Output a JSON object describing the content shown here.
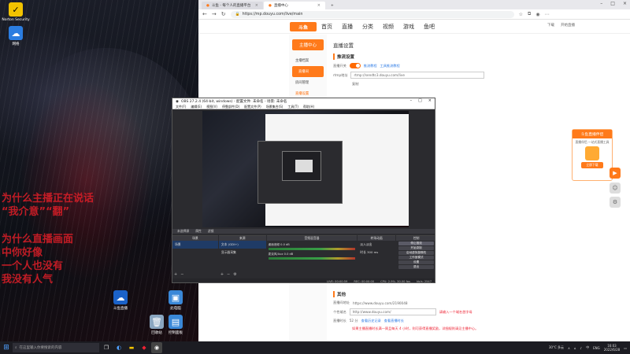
{
  "desktop": {
    "icons": [
      {
        "label": "Norton Security",
        "glyph": "✓",
        "color": "#f2c300"
      },
      {
        "label": "网络",
        "glyph": "☁",
        "color": "#2b7de0"
      },
      {
        "label": "斗鱼直播",
        "glyph": "☁",
        "color": "#1b62c8"
      },
      {
        "label": "此电脑",
        "glyph": "▣",
        "color": "#3a88d8"
      },
      {
        "label": "回收站",
        "glyph": "🗑",
        "color": "#8aa6c0"
      },
      {
        "label": "控制面板",
        "glyph": "▤",
        "color": "#3a88d8"
      }
    ],
    "red_text": [
      "为什么主播正在说话",
      "“我介意”“翻”",
      "为什么直播画面",
      "中你好像",
      "一个人也没有",
      "我没有人气"
    ]
  },
  "browser": {
    "tabs": [
      {
        "label": "斗鱼 - 每个人的直播平台"
      },
      {
        "label": "直播中心"
      }
    ],
    "nav_back": "←",
    "nav_forward": "→",
    "nav_reload": "↻",
    "url": "https://mp.douyu.com/live/main",
    "site": {
      "logo": "斗鱼",
      "nav": [
        "首页",
        "直播",
        "分类",
        "视频",
        "游戏",
        "鱼吧"
      ],
      "header_right": [
        "下载",
        "开始直播"
      ],
      "sidebar_title": "主播中心",
      "sidebar_items": [
        "主播档案",
        "直播间",
        "房间管理",
        "直播设置"
      ],
      "page_title": "直播设置",
      "section_title": "推流设置",
      "rows": [
        {
          "label": "直播开关",
          "value": "",
          "links": [
            "推流教程",
            "工具推流教程"
          ]
        },
        {
          "label": "rtmp地址",
          "value": "rtmp://sendtc3.douyu.com/live"
        },
        {
          "label": "",
          "value": "复制"
        }
      ],
      "sec2_title": "其他",
      "sec2_rows": [
        {
          "label": "直播间地址",
          "value": "https://www.douyu.com/2190048"
        },
        {
          "label": "个性域名",
          "value": "http://www.douyu.com/",
          "note": "请输入一个域名首字母"
        },
        {
          "label": "直播时长",
          "value": "52 分",
          "links": [
            "查看历史记录",
            "查看直播时长"
          ]
        }
      ],
      "footer_note": "如果主播直播时长满一周且每天 4 小时，则可获得直播奖励，详细规则请见主播中心。",
      "promo": {
        "title": "斗鱼直播伴侣",
        "subtitle": "直播伴侣 一站式直播工具",
        "button": "立即下载"
      }
    }
  },
  "obs": {
    "title": "OBS 27.2.4 (64-bit, windows) - 配置文件: 未命名 - 场景: 未命名",
    "menu": [
      "文件(F)",
      "编辑(E)",
      "视图(V)",
      "停靠部件(D)",
      "配置文件(P)",
      "场景集合(S)",
      "工具(T)",
      "帮助(H)"
    ],
    "status_line": [
      "未选择源",
      "属性",
      "滤镜"
    ],
    "docks": {
      "scenes": {
        "title": "场景",
        "items": [
          "场景"
        ]
      },
      "sources": {
        "title": "来源",
        "items": [
          "文本 (GDI+)",
          "显示器采集"
        ]
      },
      "mixer": {
        "title": "音频混音器",
        "rows": [
          {
            "label": "桌面音频",
            "value": "0.0 dB"
          },
          {
            "label": "麦克风/Aux",
            "value": "0.0 dB"
          }
        ]
      },
      "transitions": {
        "title": "转场动画",
        "items": [
          "淡入淡出",
          "时长",
          "300 ms"
        ]
      },
      "controls": {
        "title": "控制",
        "buttons": [
          "停止推流",
          "开始录制",
          "启动虚拟摄像机",
          "工作室模式",
          "设置",
          "退出"
        ]
      }
    },
    "bottom": [
      "LIVE: 00:00:59",
      "REC: 00:00:00",
      "CPU: 2.9%, 30.00 fps",
      "kb/s: 2547"
    ]
  },
  "taskbar": {
    "search_placeholder": "在这里输入你要搜索的内容",
    "tray": [
      "30°C 多云",
      "∧",
      "中",
      "ENG"
    ],
    "time": "16:03",
    "date": "2022/6/28"
  },
  "colors": {
    "accent": "#ff7a1a",
    "obs_bg": "#2b2b2f",
    "link": "#2d7be5"
  }
}
